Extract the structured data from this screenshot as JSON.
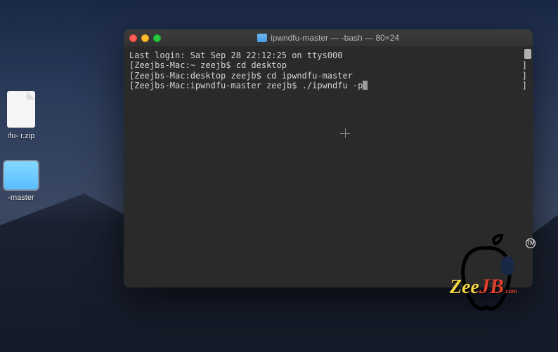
{
  "desktop": {
    "icon1_label": "ifu-\nr.zip",
    "icon2_label": "-master"
  },
  "terminal": {
    "window_title": "ipwndfu-master — -bash — 80×24",
    "lines": {
      "l1": "Last login: Sat Sep 28 22:12:25 on ttys000",
      "l2_prompt": "Zeejbs-Mac:~ zeejb$ ",
      "l2_cmd": "cd desktop",
      "l3_prompt": "Zeejbs-Mac:desktop zeejb$ ",
      "l3_cmd": "cd ipwndfu-master",
      "l4_prompt": "Zeejbs-Mac:ipwndfu-master zeejb$ ",
      "l4_cmd": "./ipwndfu -p"
    }
  },
  "logo": {
    "zee": "Zee",
    "jb": "JB",
    "com": ".com",
    "tm": "TM"
  }
}
